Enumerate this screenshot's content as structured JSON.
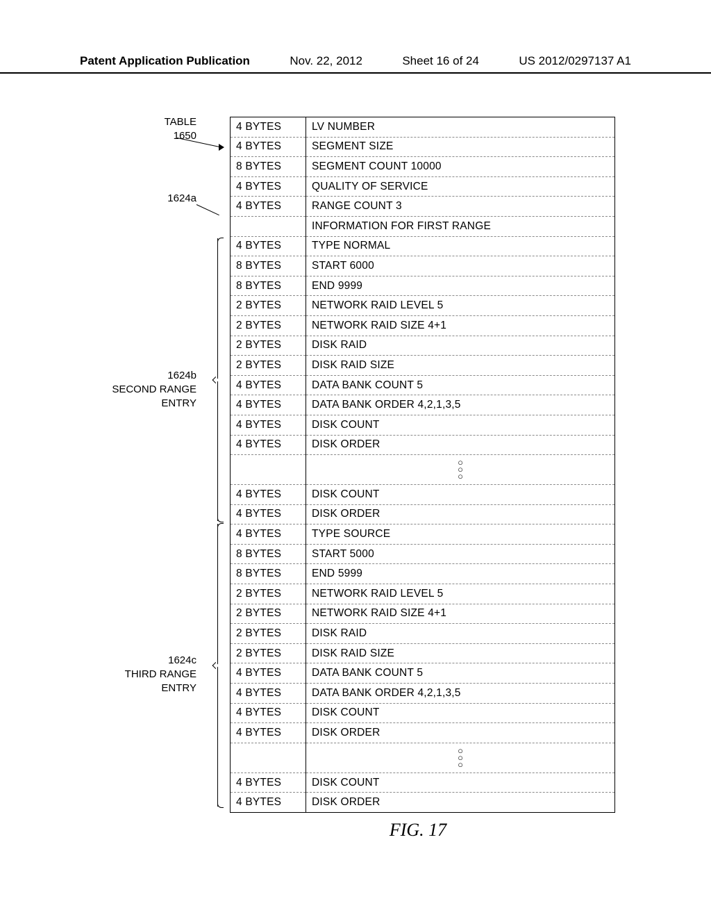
{
  "header": {
    "left": "Patent Application Publication",
    "date": "Nov. 22, 2012",
    "sheet": "Sheet 16 of 24",
    "pubno": "US 2012/0297137 A1"
  },
  "labels": {
    "table_line1": "TABLE",
    "table_line2": "1650",
    "r1": "1624a",
    "r2_line1": "1624b",
    "r2_line2": "SECOND RANGE",
    "r2_line3": "ENTRY",
    "r3_line1": "1624c",
    "r3_line2": "THIRD RANGE",
    "r3_line3": "ENTRY"
  },
  "rows": [
    {
      "size": "4 BYTES",
      "desc": "LV NUMBER"
    },
    {
      "size": "4 BYTES",
      "desc": "SEGMENT SIZE"
    },
    {
      "size": "8 BYTES",
      "desc": "SEGMENT COUNT 10000"
    },
    {
      "size": "4 BYTES",
      "desc": "QUALITY OF SERVICE"
    },
    {
      "size": "4 BYTES",
      "desc": "RANGE COUNT 3"
    },
    {
      "size": "",
      "desc": "INFORMATION FOR FIRST RANGE"
    },
    {
      "size": "4 BYTES",
      "desc": "TYPE NORMAL"
    },
    {
      "size": "8 BYTES",
      "desc": "START 6000"
    },
    {
      "size": "8 BYTES",
      "desc": "END 9999"
    },
    {
      "size": "2 BYTES",
      "desc": "NETWORK RAID LEVEL 5"
    },
    {
      "size": "2 BYTES",
      "desc": "NETWORK RAID SIZE 4+1"
    },
    {
      "size": "2 BYTES",
      "desc": "DISK RAID"
    },
    {
      "size": "2 BYTES",
      "desc": "DISK RAID SIZE"
    },
    {
      "size": "4 BYTES",
      "desc": "DATA BANK COUNT 5"
    },
    {
      "size": "4 BYTES",
      "desc": "DATA BANK ORDER 4,2,1,3,5"
    },
    {
      "size": "4 BYTES",
      "desc": "DISK COUNT"
    },
    {
      "size": "4 BYTES",
      "desc": "DISK ORDER"
    },
    {
      "ellipsis": true
    },
    {
      "size": "4 BYTES",
      "desc": "DISK COUNT"
    },
    {
      "size": "4 BYTES",
      "desc": "DISK ORDER"
    },
    {
      "size": "4 BYTES",
      "desc": "TYPE SOURCE"
    },
    {
      "size": "8 BYTES",
      "desc": "START 5000"
    },
    {
      "size": "8 BYTES",
      "desc": "END 5999"
    },
    {
      "size": "2 BYTES",
      "desc": "NETWORK RAID LEVEL 5"
    },
    {
      "size": "2 BYTES",
      "desc": "NETWORK RAID SIZE 4+1"
    },
    {
      "size": "2 BYTES",
      "desc": "DISK RAID"
    },
    {
      "size": "2 BYTES",
      "desc": "DISK RAID SIZE"
    },
    {
      "size": "4 BYTES",
      "desc": "DATA BANK COUNT 5"
    },
    {
      "size": "4 BYTES",
      "desc": "DATA BANK ORDER 4,2,1,3,5"
    },
    {
      "size": "4 BYTES",
      "desc": "DISK COUNT"
    },
    {
      "size": "4 BYTES",
      "desc": "DISK ORDER"
    },
    {
      "ellipsis": true
    },
    {
      "size": "4 BYTES",
      "desc": "DISK COUNT"
    },
    {
      "size": "4 BYTES",
      "desc": "DISK ORDER"
    }
  ],
  "figure_caption": "FIG. 17"
}
